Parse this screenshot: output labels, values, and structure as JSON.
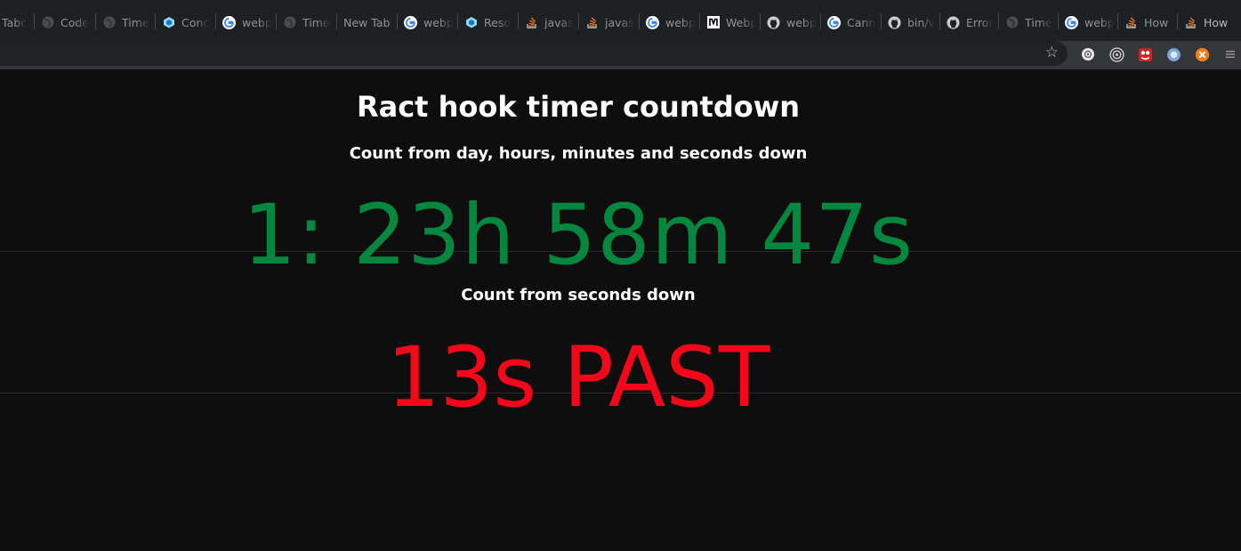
{
  "browser": {
    "tabs": [
      {
        "label": "Tabc",
        "icon": "none"
      },
      {
        "label": "Code",
        "icon": "globe-icon"
      },
      {
        "label": "Time",
        "icon": "globe-icon"
      },
      {
        "label": "Conc",
        "icon": "cube-icon"
      },
      {
        "label": "webp",
        "icon": "google-icon"
      },
      {
        "label": "Time",
        "icon": "globe-icon"
      },
      {
        "label": "New Tab",
        "icon": "none"
      },
      {
        "label": "webp",
        "icon": "google-icon"
      },
      {
        "label": "Reso",
        "icon": "cube-icon"
      },
      {
        "label": "javas",
        "icon": "stackoverflow-icon"
      },
      {
        "label": "javas",
        "icon": "stackoverflow-icon"
      },
      {
        "label": "webp",
        "icon": "google-icon"
      },
      {
        "label": "Webp",
        "icon": "medium-icon"
      },
      {
        "label": "webp",
        "icon": "github-icon"
      },
      {
        "label": "Cann",
        "icon": "google-icon"
      },
      {
        "label": "bin/v",
        "icon": "github-icon"
      },
      {
        "label": "Error",
        "icon": "github-icon"
      },
      {
        "label": "Time",
        "icon": "globe-icon"
      },
      {
        "label": "webp",
        "icon": "google-icon"
      },
      {
        "label": "How",
        "icon": "stackoverflow-icon"
      },
      {
        "label": "How",
        "icon": "stackoverflow-icon"
      }
    ],
    "extensions": [
      "privacy-extension-icon",
      "target-extension-icon",
      "red-extension-icon",
      "blue-extension-icon",
      "orange-extension-icon",
      "menu-extension-icon"
    ]
  },
  "page": {
    "title": "Ract hook timer countdown",
    "subtitle_days": "Count from day, hours, minutes and seconds down",
    "countdown_days": "1: 23h 58m 47s",
    "subtitle_seconds": "Count from seconds down",
    "countdown_seconds": "13s PAST"
  },
  "colors": {
    "background": "#0e0e0e",
    "countdown_green": "#05873f",
    "past_red": "#f2081a",
    "heading_white": "#ffffff"
  }
}
